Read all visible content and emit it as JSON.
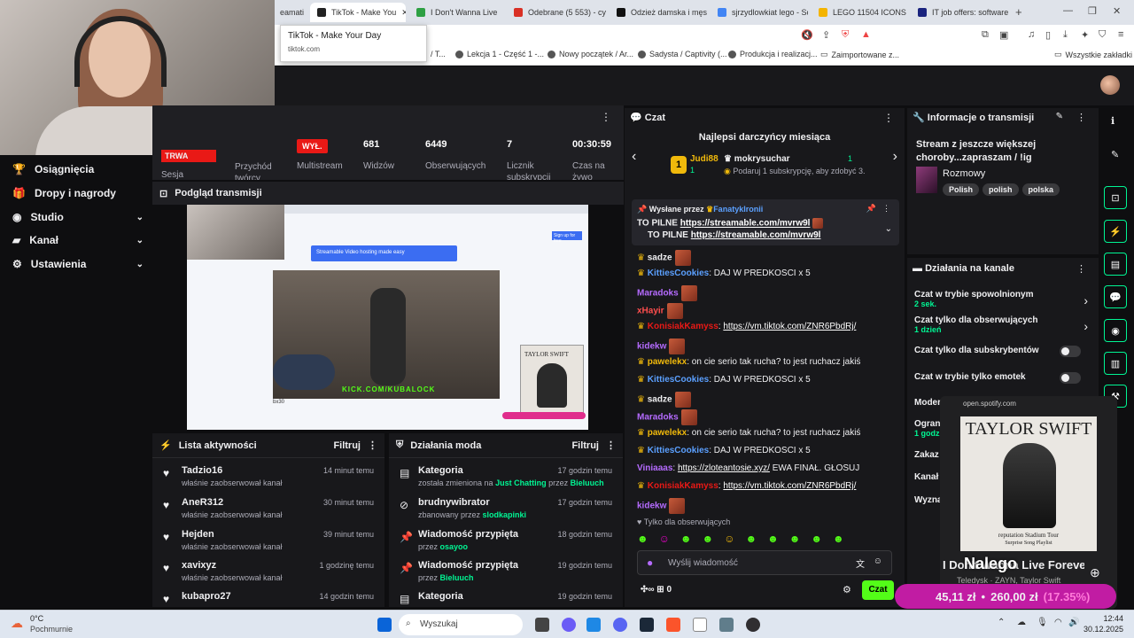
{
  "browser": {
    "tabs": [
      {
        "label": "eamati",
        "color": "#888"
      },
      {
        "label": "TikTok - Make You",
        "color": "#222",
        "active": true
      },
      {
        "label": "I Don't Wanna Live",
        "color": "#2ea043"
      },
      {
        "label": "Odebrane (5 553) - cyp",
        "color": "#d93025"
      },
      {
        "label": "Odzież damska i męska",
        "color": "#111"
      },
      {
        "label": "sjrzydlowkiat lego - So",
        "color": "#4285f4"
      },
      {
        "label": "LEGO 11504 ICONS Si",
        "color": "#f4b400"
      },
      {
        "label": "IT job offers: software",
        "color": "#1a237e"
      }
    ],
    "tooltip_title": "TikTok - Make Your Day",
    "tooltip_url": "tiktok.com",
    "bookmarks": [
      "/ T...",
      "Lekcja 1 - Część 1 -...",
      "Nowy początek / Ar...",
      "Sadysta / Captivity (...",
      "Produkcja i realizacj...",
      "Zaimportowane z..."
    ],
    "all_bookmarks": "Wszystkie zakładki"
  },
  "sidebar": {
    "items": [
      {
        "label": "Osiągnięcia",
        "icon": "trophy-icon"
      },
      {
        "label": "Dropy i nagrody",
        "icon": "gift-icon"
      },
      {
        "label": "Studio",
        "icon": "studio-icon"
      },
      {
        "label": "Kanał",
        "icon": "channel-icon"
      },
      {
        "label": "Ustawienia",
        "icon": "gear-icon"
      }
    ]
  },
  "stats": {
    "status_badge": "TRWA",
    "session_label": "Sesja",
    "revenue_label": "Przychód twórcy",
    "multistream_badge": "WYŁ.",
    "multistream_label": "Multistream",
    "viewers_value": "681",
    "viewers_label": "Widzów",
    "followers_value": "6449",
    "followers_label": "Obserwujących",
    "subs_value": "7",
    "subs_label": "Licznik subskrypcji",
    "time_value": "00:30:59",
    "time_label": "Czas na żywo"
  },
  "preview": {
    "title": "Podgląd transmisji",
    "site_name": "Streamable",
    "site_tagline": "Video hosting made easy",
    "button": "Sign up for free",
    "kick_text": "KICK.COM/KUBALOCK",
    "video_caption": "bx30",
    "album_artist": "TAYLOR SWIFT"
  },
  "activity": {
    "title": "Lista aktywności",
    "filter": "Filtruj",
    "rows": [
      {
        "name": "Tadzio16",
        "sub": "właśnie zaobserwował kanał",
        "time": "14 minut temu"
      },
      {
        "name": "AneR312",
        "sub": "właśnie zaobserwował kanał",
        "time": "30 minut temu"
      },
      {
        "name": "Hejden",
        "sub": "właśnie zaobserwował kanał",
        "time": "39 minut temu"
      },
      {
        "name": "xavixyz",
        "sub": "właśnie zaobserwował kanał",
        "time": "1 godzinę temu"
      },
      {
        "name": "kubapro27",
        "sub": "",
        "time": "14 godzin temu"
      }
    ]
  },
  "mod": {
    "title": "Działania moda",
    "filter": "Filtruj",
    "rows": [
      {
        "name": "Kategoria",
        "pre": "została zmieniona na ",
        "hl1": "Just Chatting",
        "mid": " przez ",
        "hl2": "Bieluuch",
        "time": "17 godzin temu",
        "icon": "category-icon"
      },
      {
        "name": "brudnywibrator",
        "pre": "zbanowany przez ",
        "hl1": "slodkapinki",
        "mid": "",
        "hl2": "",
        "time": "17 godzin temu",
        "icon": "ban-icon"
      },
      {
        "name": "Wiadomość przypięta",
        "pre": "przez ",
        "hl1": "osayoo",
        "mid": "",
        "hl2": "",
        "time": "18 godzin temu",
        "icon": "pin-icon"
      },
      {
        "name": "Wiadomość przypięta",
        "pre": "przez ",
        "hl1": "Bieluuch",
        "mid": "",
        "hl2": "",
        "time": "19 godzin temu",
        "icon": "pin-icon"
      },
      {
        "name": "Kategoria",
        "pre": "",
        "hl1": "",
        "mid": "",
        "hl2": "",
        "time": "19 godzin temu",
        "icon": "category-icon"
      }
    ]
  },
  "chat": {
    "title": "Czat",
    "top_gifters": "Najlepsi darczyńcy miesiąca",
    "gifter1_name": "Judi88",
    "gifter1_count": "1",
    "gifter2_name": "mokrysuchar",
    "gifter2_count": "1",
    "gift_hint": "Podaruj 1 subskrypcję, aby zdobyć 3.",
    "pinned_by_label": "Wysłane przez",
    "pinned_by_user": "FanatykIronii",
    "pinned_line1": "TO PILNE",
    "pinned_link": "https://streamable.com/mvrw9l",
    "pinned_line2": "TO PILNE",
    "messages": [
      {
        "user": "sadze",
        "color": "#efeff1",
        "text": "",
        "emote": true
      },
      {
        "user": "KittiesCookies",
        "color": "#5ba0ff",
        "text": ": DAJ W PREDKOSCI x 5",
        "emote": false
      },
      {
        "user": "Maradoks",
        "color": "#b56bff",
        "text": "",
        "emote": true
      },
      {
        "user": "xHayir",
        "color": "#ff4e4e",
        "text": "",
        "emote": true
      },
      {
        "user": "KonisiakKamyss",
        "color": "#e91916",
        "text": ": ",
        "link": "https://vm.tiktok.com/ZNR6PbdRj/",
        "emote": false
      },
      {
        "user": "kidekw",
        "color": "#b56bff",
        "text": "",
        "emote": true
      },
      {
        "user": "pawelekx",
        "color": "#f0b90b",
        "text": ": on cie serio tak rucha? to jest ruchacz jakiś",
        "emote": false
      },
      {
        "user": "KittiesCookies",
        "color": "#5ba0ff",
        "text": ": DAJ W PREDKOSCI x 5",
        "emote": false
      },
      {
        "user": "sadze",
        "color": "#efeff1",
        "text": "",
        "emote": true
      },
      {
        "user": "Maradoks",
        "color": "#b56bff",
        "text": "",
        "emote": true
      },
      {
        "user": "pawelekx",
        "color": "#f0b90b",
        "text": ": on cie serio tak rucha? to jest ruchacz jakiś",
        "emote": false
      },
      {
        "user": "KittiesCookies",
        "color": "#5ba0ff",
        "text": ": DAJ W PREDKOSCI x 5",
        "emote": false
      },
      {
        "user": "Viniaaas",
        "color": "#b56bff",
        "text": ": ",
        "link": "https://zloteantosie.xyz/",
        "after": " EWA FINAŁ. GŁOSUJ",
        "emote": false
      },
      {
        "user": "KonisiakKamyss",
        "color": "#e91916",
        "text": ": ",
        "link": "https://vm.tiktok.com/ZNR6PbdRj/",
        "emote": false
      },
      {
        "user": "kidekw",
        "color": "#b56bff",
        "text": "",
        "emote": true
      }
    ],
    "followers_only": "Tylko dla obserwujących",
    "input_placeholder": "Wyślij wiadomość",
    "points": "0",
    "send": "Czat"
  },
  "info": {
    "title": "Informacje o transmisji",
    "stream_title": "Stream z jeszcze większej choroby...zapraszam / !ig",
    "category": "Rozmowy",
    "tags": [
      "Polish",
      "polish",
      "polska"
    ]
  },
  "mod_actions": {
    "title": "Działania na kanale",
    "slow_mode": "Czat w trybie spowolnionym",
    "slow_value": "2 sek.",
    "followers_mode": "Czat tylko dla obserwujących",
    "followers_value": "1 dzień",
    "subs_mode": "Czat tylko dla subskrybentów",
    "emote_mode": "Czat w trybie tylko emotek",
    "cut1": "Moder",
    "cut2": "Ogran",
    "cut2_value": "1 godz.",
    "cut3": "Zakaz",
    "cut4": "Kanał",
    "cut5": "Wyzna"
  },
  "spotify": {
    "url": "open.spotify.com",
    "album_artist": "TAYLOR SWIFT",
    "album_sub1": "reputation Stadium Tour",
    "album_sub2": "Surprise Song Playlist",
    "track": "I Don't Wanna Live Foreve",
    "overlay": "Nalego",
    "artist": "Teledysk · ZAYN, Taylor Swift"
  },
  "donation": {
    "current": "45,11 zł",
    "sep": "•",
    "goal": "260,00 zł",
    "percent": "(17.35%)"
  },
  "taskbar": {
    "weather_temp": "0°C",
    "weather_desc": "Pochmurnie",
    "search": "Wyszukaj",
    "time": "12:44",
    "date": "30.12.2025"
  }
}
